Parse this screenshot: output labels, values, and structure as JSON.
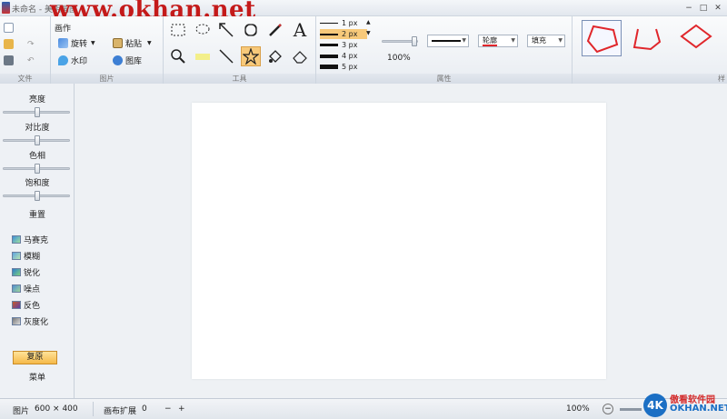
{
  "titlebar": {
    "title": "未命名 - 美明画图",
    "watermark": "www.okhan.net",
    "minimize": "−",
    "maximize": "□",
    "close": "✕"
  },
  "ribbon": {
    "file": {
      "label": "文件",
      "menu_label": "画作"
    },
    "image": {
      "label": "图片",
      "rotate": "旋转",
      "paste": "粘贴",
      "watermark": "水印",
      "gallery": "图库"
    },
    "tools": {
      "label": "工具",
      "text_tool": "A"
    },
    "properties": {
      "label": "属性",
      "line_widths": [
        "1 px",
        "2 px",
        "3 px",
        "4 px",
        "5 px"
      ],
      "selected_width": "2 px",
      "opacity": "100%",
      "outline": "轮廓",
      "fill": "填充"
    },
    "shapes": {
      "label": "样",
      "selected": "pentagon"
    }
  },
  "left_panel": {
    "adjustments": [
      "亮度",
      "对比度",
      "色相",
      "饱和度"
    ],
    "reset": "重置",
    "effects": [
      "马赛克",
      "模糊",
      "锐化",
      "噪点",
      "反色",
      "灰度化"
    ],
    "restore": "复原",
    "menu": "菜单"
  },
  "statusbar": {
    "image_label": "图片",
    "image_size": "600 × 400",
    "canvas_expand": "画布扩展",
    "canvas_expand_value": "0",
    "minus": "−",
    "plus": "+",
    "zoom": "100%",
    "logo_4k": "4K",
    "logo_cn": "傲看软件园",
    "logo_en": "OKHAN.NET"
  },
  "colors": {
    "accent": "#f7c97a",
    "shape_red": "#e0262b",
    "brand_blue": "#1b6fc4"
  }
}
